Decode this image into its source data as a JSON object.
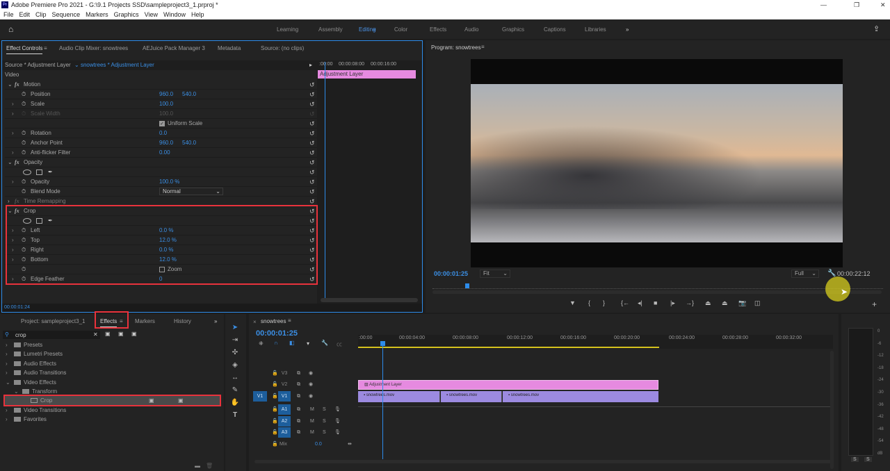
{
  "window": {
    "app_icon": "Pr",
    "title": "Adobe Premiere Pro 2021 - G:\\9.1 Projects SSD\\sampleproject3_1.prproj *",
    "minimize": "—",
    "maximize": "❐",
    "close": "✕"
  },
  "menu": [
    "File",
    "Edit",
    "Clip",
    "Sequence",
    "Markers",
    "Graphics",
    "View",
    "Window",
    "Help"
  ],
  "workspaces": [
    "Learning",
    "Assembly",
    "Editing",
    "Color",
    "Effects",
    "Audio",
    "Graphics",
    "Captions",
    "Libraries"
  ],
  "workspace_active": "Editing",
  "workspace_more": "»",
  "effect_controls": {
    "tabs": [
      "Effect Controls",
      "Audio Clip Mixer: snowtrees",
      "AEJuice Pack Manager 3",
      "Metadata",
      "Source: (no clips)"
    ],
    "source_label": "Source * Adjustment Layer",
    "clip_label": "snowtrees * Adjustment Layer",
    "mini_timecodes": [
      ":00:00",
      "00:00:08:00",
      "00:00:16:00"
    ],
    "mini_clip": "Adjustment Layer",
    "section_video": "Video",
    "rows": [
      {
        "kind": "fx",
        "label": "Motion"
      },
      {
        "kind": "prop",
        "label": "Position",
        "v1": "960.0",
        "v2": "540.0"
      },
      {
        "kind": "prop",
        "label": "Scale",
        "v1": "100.0",
        "exp": true
      },
      {
        "kind": "prop",
        "label": "Scale Width",
        "v1": "100.0",
        "exp": true,
        "dim": true
      },
      {
        "kind": "check",
        "label": "Uniform Scale",
        "checked": true
      },
      {
        "kind": "prop",
        "label": "Rotation",
        "v1": "0.0",
        "exp": true
      },
      {
        "kind": "prop",
        "label": "Anchor Point",
        "v1": "960.0",
        "v2": "540.0"
      },
      {
        "kind": "prop",
        "label": "Anti-flicker Filter",
        "v1": "0.00",
        "exp": true
      },
      {
        "kind": "fx",
        "label": "Opacity"
      },
      {
        "kind": "masks"
      },
      {
        "kind": "prop",
        "label": "Opacity",
        "v1": "100.0 %",
        "exp": true
      },
      {
        "kind": "select",
        "label": "Blend Mode",
        "v1": "Normal"
      },
      {
        "kind": "fx",
        "label": "Time Remapping",
        "collapsed": true
      },
      {
        "kind": "fx",
        "label": "Crop"
      },
      {
        "kind": "masks"
      },
      {
        "kind": "prop",
        "label": "Left",
        "v1": "0.0 %",
        "exp": true
      },
      {
        "kind": "prop",
        "label": "Top",
        "v1": "12.0 %",
        "exp": true
      },
      {
        "kind": "prop",
        "label": "Right",
        "v1": "0.0 %",
        "exp": true
      },
      {
        "kind": "prop",
        "label": "Bottom",
        "v1": "12.0 %",
        "exp": true
      },
      {
        "kind": "check",
        "label": "Zoom",
        "checked": false,
        "stopwatch": true
      },
      {
        "kind": "prop",
        "label": "Edge Feather",
        "v1": "0",
        "exp": true
      }
    ],
    "timecode": "00:00:01:24"
  },
  "program": {
    "title": "Program: snowtrees",
    "timecode": "00:00:01:25",
    "fit": "Fit",
    "quality": "Full",
    "duration": "00:00:22:12"
  },
  "project_panel": {
    "tabs": [
      "Project: sampleproject3_1",
      "Effects",
      "Markers",
      "History"
    ],
    "more": "»",
    "search": "crop",
    "items": [
      {
        "label": "Presets",
        "level": 0,
        "open": false
      },
      {
        "label": "Lumetri Presets",
        "level": 0,
        "open": false
      },
      {
        "label": "Audio Effects",
        "level": 0,
        "open": false
      },
      {
        "label": "Audio Transitions",
        "level": 0,
        "open": false
      },
      {
        "label": "Video Effects",
        "level": 0,
        "open": true
      },
      {
        "label": "Transform",
        "level": 1,
        "open": true
      },
      {
        "label": "Crop",
        "level": 2,
        "selected": true
      },
      {
        "label": "Video Transitions",
        "level": 0,
        "open": false
      },
      {
        "label": "Favorites",
        "level": 0,
        "open": false
      }
    ]
  },
  "timeline": {
    "sequence": "snowtrees",
    "timecode": "00:00:01:25",
    "ruler": [
      ":00:00",
      "00:00:04:00",
      "00:00:08:00",
      "00:00:12:00",
      "00:00:16:00",
      "00:00:20:00",
      "00:00:24:00",
      "00:00:28:00",
      "00:00:32:00"
    ],
    "tracks": {
      "v3": "V3",
      "v2": "V2",
      "v1": "V1",
      "src_v1": "V1",
      "a1": "A1",
      "a2": "A2",
      "a3": "A3",
      "mute": "M",
      "solo": "S",
      "mix": "Mix",
      "mix_value": "0.0"
    },
    "clips": {
      "adjustment": "Adjustment Layer",
      "v1": [
        "snowtrees.mov",
        "snowtrees.mov",
        "snowtrees.mov"
      ]
    },
    "playhead_seconds": 1.8
  },
  "meters": {
    "labels": [
      "0",
      "-6",
      "-12",
      "-18",
      "-24",
      "-30",
      "-36",
      "-42",
      "-48",
      "-54",
      "dB"
    ],
    "solo": [
      "S",
      "S"
    ]
  },
  "colors": {
    "accent": "#2d8ceb",
    "adjustment_clip": "#e68ae0",
    "video_clip": "#9c8ae0",
    "highlight": "#e8323c"
  }
}
